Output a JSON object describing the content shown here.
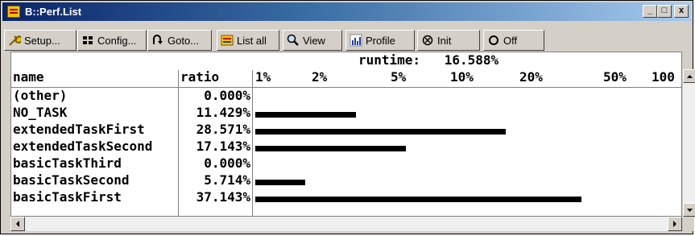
{
  "window": {
    "title": "B::Perf.List"
  },
  "titlebar_buttons": {
    "minimize": "_",
    "maximize": "□",
    "close": "x"
  },
  "toolbar": {
    "buttons": [
      {
        "label": "Setup...",
        "icon": "wrench-icon"
      },
      {
        "label": "Config...",
        "icon": "grid-icon"
      },
      {
        "label": "Goto...",
        "icon": "goto-arrow-icon"
      },
      {
        "label": "List all",
        "icon": "list-icon"
      },
      {
        "label": "View",
        "icon": "magnifier-icon"
      },
      {
        "label": "Profile",
        "icon": "bar-chart-icon"
      },
      {
        "label": "Init",
        "icon": "init-icon"
      },
      {
        "label": "Off",
        "icon": "off-circle-icon"
      }
    ]
  },
  "summary": {
    "label": "runtime:",
    "value": "16.588%"
  },
  "columns": {
    "name": "name",
    "ratio": "ratio",
    "scale": [
      "1%",
      "2%",
      "5%",
      "10%",
      "20%",
      "50%",
      "100"
    ]
  },
  "rows": [
    {
      "name": "(other)",
      "ratio": "0.000%",
      "value": 0.0
    },
    {
      "name": "NO_TASK",
      "ratio": "11.429%",
      "value": 11.429
    },
    {
      "name": "extendedTaskFirst",
      "ratio": "28.571%",
      "value": 28.571
    },
    {
      "name": "extendedTaskSecond",
      "ratio": "17.143%",
      "value": 17.143
    },
    {
      "name": "basicTaskThird",
      "ratio": "0.000%",
      "value": 0.0
    },
    {
      "name": "basicTaskSecond",
      "ratio": "5.714%",
      "value": 5.714
    },
    {
      "name": "basicTaskFirst",
      "ratio": "37.143%",
      "value": 37.143
    }
  ],
  "colors": {
    "title_bar": "#0a246a",
    "bar": "#000000",
    "face": "#d4d0c8"
  }
}
